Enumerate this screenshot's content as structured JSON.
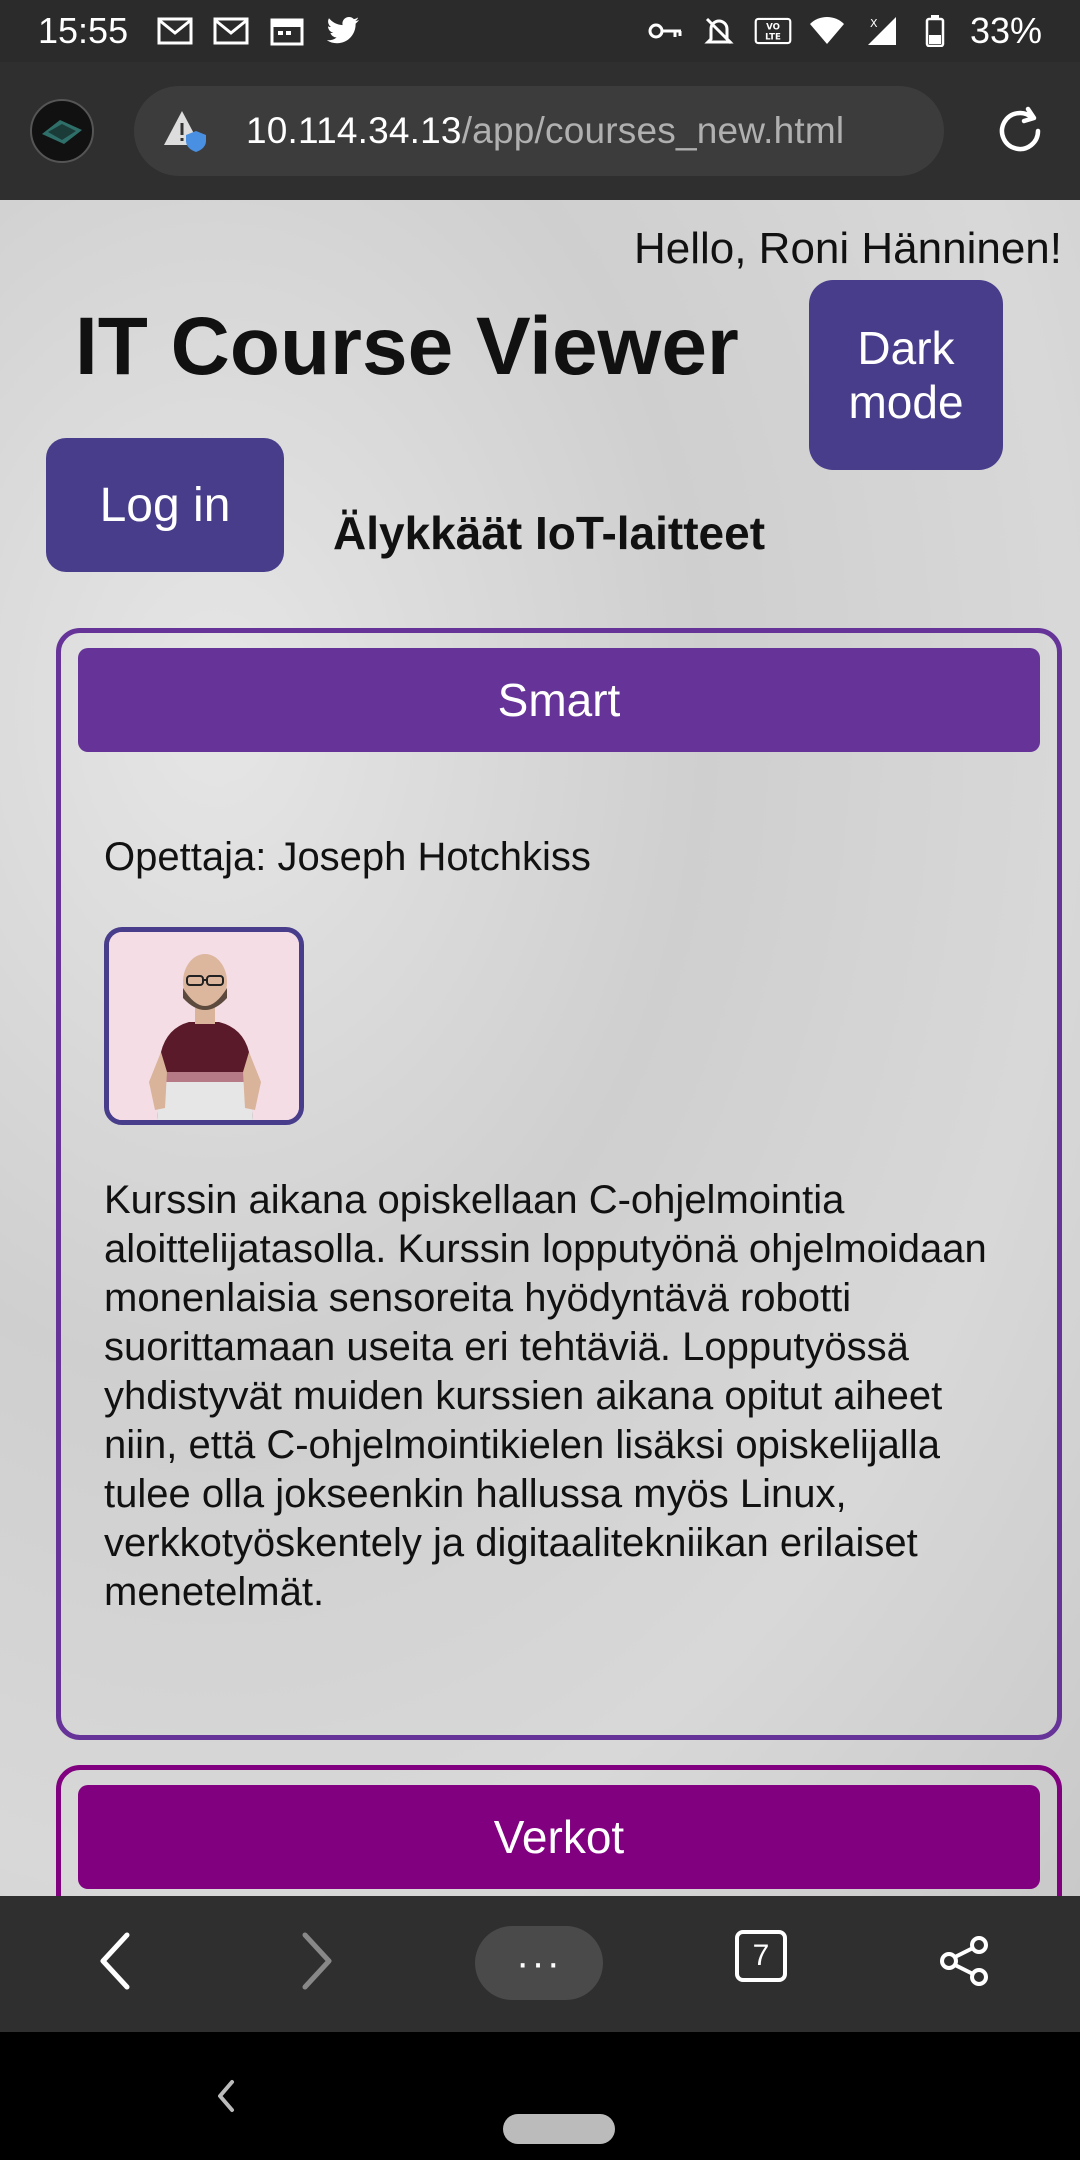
{
  "status_bar": {
    "time": "15:55",
    "battery": "33%",
    "icons": [
      "gmail-icon",
      "gmail-icon",
      "calendar-icon",
      "twitter-icon",
      "key-icon",
      "silent-icon",
      "volte-icon",
      "wifi-icon",
      "signal-icon",
      "battery-icon"
    ],
    "volte_label": "VO LTE"
  },
  "browser": {
    "url_host": "10.114.34.13",
    "url_path": "/app/courses_new.html"
  },
  "page": {
    "greeting": "Hello, Roni Hänninen!",
    "title": "IT Course Viewer",
    "dark_mode_label_line1": "Dark",
    "dark_mode_label_line2": "mode",
    "login_label": "Log in",
    "subtitle": "Älykkäät IoT-laitteet"
  },
  "courses": [
    {
      "name": "Smart",
      "teacher": "Opettaja: Joseph Hotchkiss",
      "description": "Kurssin aikana opiskellaan C-ohjelmointia aloittelijatasolla. Kurssin lopputyönä ohjelmoidaan monenlaisia sensoreita hyödyntävä robotti suorittamaan useita eri tehtäviä. Lopputyössä yhdistyvät muiden kurssien aikana opitut aiheet niin, että C-ohjelmointikielen lisäksi opiskelijalla tulee olla jokseenkin hallussa myös Linux, verkkotyöskentely ja digitaalitekniikan erilaiset menetelmät.",
      "color": "#663399"
    },
    {
      "name": "Verkot",
      "color": "#800080"
    }
  ],
  "toolbar": {
    "menu_label": "···",
    "tab_count": "7"
  },
  "colors": {
    "accent": "#483d8b",
    "card_smart": "#663399",
    "card_verkot": "#800080"
  }
}
